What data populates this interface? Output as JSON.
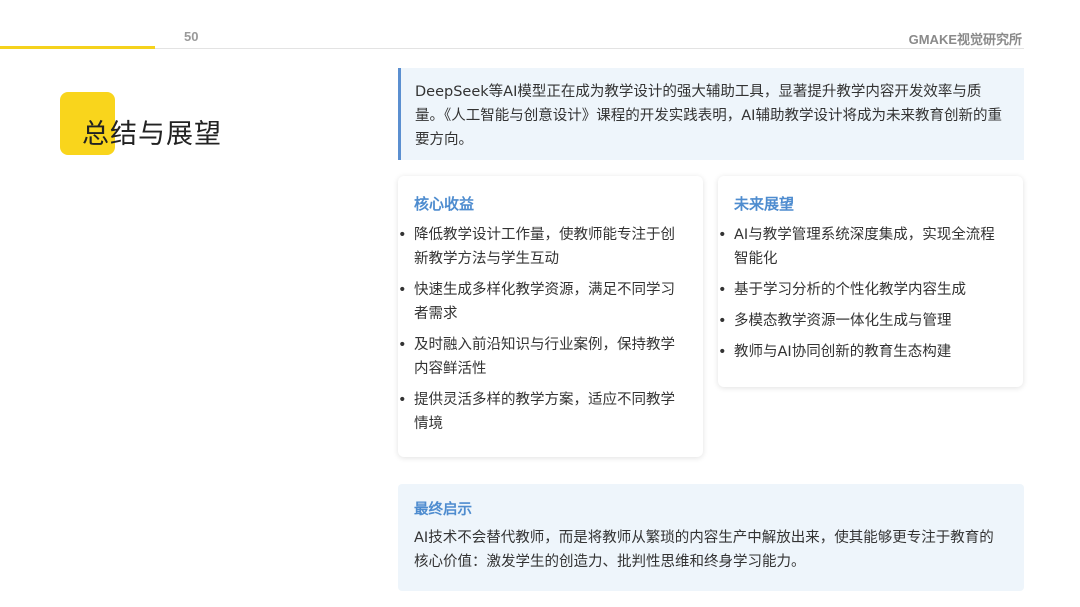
{
  "header": {
    "page_number": "50",
    "brand": "GMAKE视觉研究所"
  },
  "title": "总结与展望",
  "intro": "DeepSeek等AI模型正在成为教学设计的强大辅助工具，显著提升教学内容开发效率与质量。《人工智能与创意设计》课程的开发实践表明，AI辅助教学设计将成为未来教育创新的重要方向。",
  "core_benefits": {
    "title": "核心收益",
    "items": [
      "降低教学设计工作量，使教师能专注于创新教学方法与学生互动",
      "快速生成多样化教学资源，满足不同学习者需求",
      "及时融入前沿知识与行业案例，保持教学内容鲜活性",
      "提供灵活多样的教学方案，适应不同教学情境"
    ]
  },
  "future_outlook": {
    "title": "未来展望",
    "items": [
      "AI与教学管理系统深度集成，实现全流程智能化",
      "基于学习分析的个性化教学内容生成",
      "多模态教学资源一体化生成与管理",
      "教师与AI协同创新的教育生态构建"
    ]
  },
  "final_insight": {
    "title": "最终启示",
    "text": "AI技术不会替代教师，而是将教师从繁琐的内容生产中解放出来，使其能够更专注于教育的核心价值：激发学生的创造力、批判性思维和终身学习能力。"
  },
  "colors": {
    "accent_yellow": "#f9d51c",
    "accent_blue": "#4e8ccf",
    "panel_bg": "#eef5fb"
  }
}
